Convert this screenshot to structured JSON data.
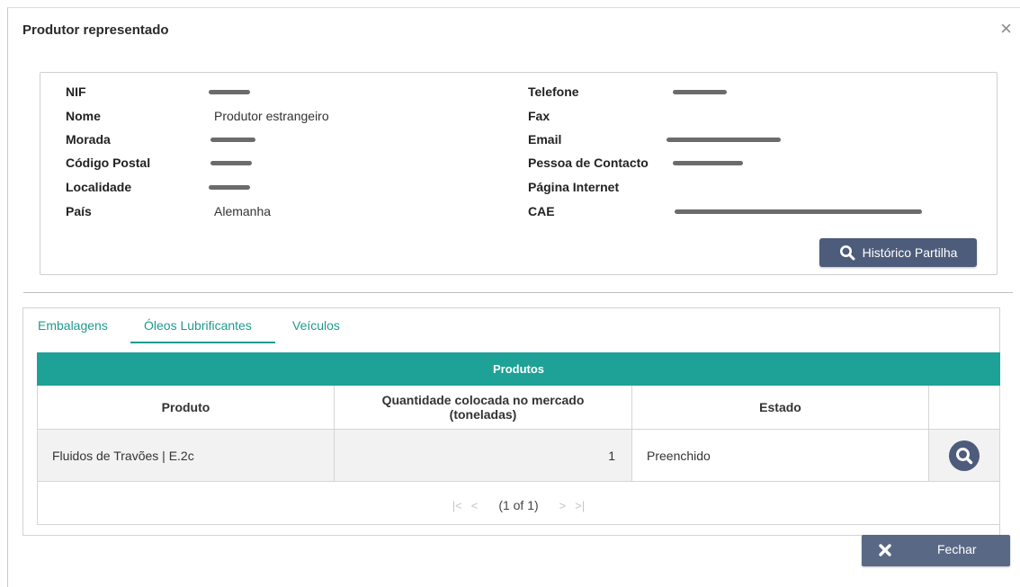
{
  "dialog": {
    "title": "Produtor representado",
    "close_glyph": "×"
  },
  "producer": {
    "left": [
      {
        "label": "NIF",
        "value": ""
      },
      {
        "label": "Nome",
        "value": "Produtor estrangeiro"
      },
      {
        "label": "Morada",
        "value": ""
      },
      {
        "label": "Código Postal",
        "value": ""
      },
      {
        "label": "Localidade",
        "value": ""
      },
      {
        "label": "País",
        "value": "Alemanha"
      }
    ],
    "right": [
      {
        "label": "Telefone",
        "value": ""
      },
      {
        "label": "Fax",
        "value": ""
      },
      {
        "label": "Email",
        "value": ""
      },
      {
        "label": "Pessoa de Contacto",
        "value": ""
      },
      {
        "label": "Página Internet",
        "value": ""
      },
      {
        "label": "CAE",
        "value": ""
      }
    ],
    "history_button": "Histórico Partilha"
  },
  "tabs": [
    "Embalagens",
    "Óleos Lubrificantes",
    "Veículos"
  ],
  "active_tab": "Óleos Lubrificantes",
  "table": {
    "caption": "Produtos",
    "headers": [
      "Produto",
      "Quantidade colocada no mercado (toneladas)",
      "Estado"
    ],
    "rows": [
      {
        "produto": "Fluidos de Travões | E.2c",
        "quantidade": "1",
        "estado": "Preenchido"
      }
    ]
  },
  "pager": {
    "first": "|<",
    "prev": "<",
    "info": "(1 of 1)",
    "next": ">",
    "last": ">|"
  },
  "footer": {
    "close_button": "Fechar"
  },
  "colors": {
    "accent": "#1ea196",
    "button": "#4d5c7a"
  },
  "icons": [
    "close-icon",
    "search-icon",
    "times-icon"
  ]
}
